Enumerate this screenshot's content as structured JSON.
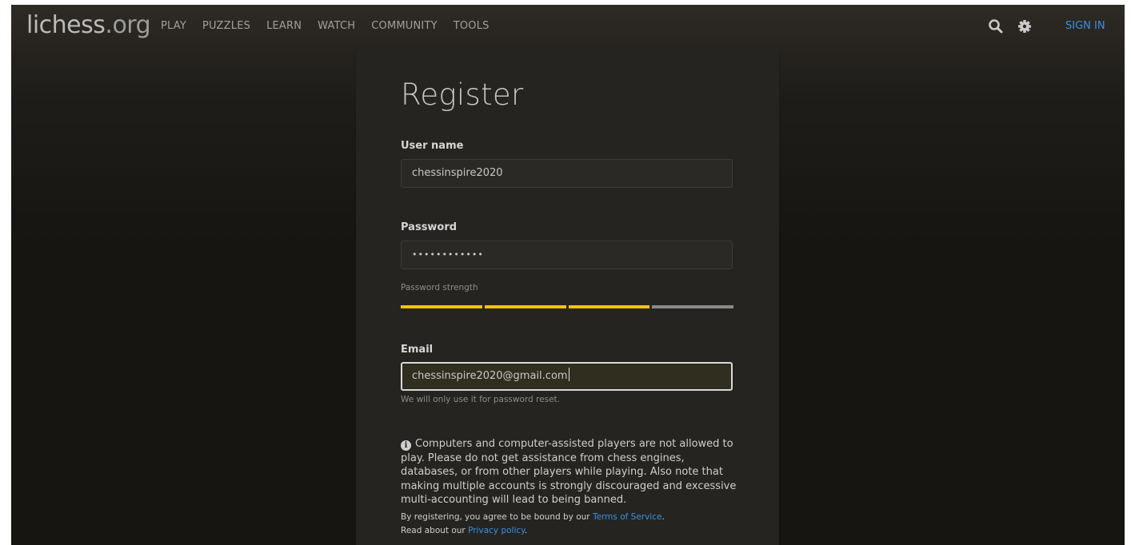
{
  "header": {
    "logo_main": "lichess",
    "logo_tld": ".org",
    "nav": [
      "PLAY",
      "PUZZLES",
      "LEARN",
      "WATCH",
      "COMMUNITY",
      "TOOLS"
    ],
    "sign_in": "SIGN IN",
    "icons": [
      "search-icon",
      "gear-icon"
    ]
  },
  "form": {
    "title": "Register",
    "username_label": "User name",
    "username_value": "chessinspire2020",
    "password_label": "Password",
    "password_value": "••••••••••••",
    "strength_label": "Password strength",
    "strength_level": 0.75,
    "email_label": "Email",
    "email_value": "chessinspire2020@gmail.com",
    "email_hint": "We will only use it for password reset."
  },
  "notice": {
    "icon": "info-icon",
    "text": "Computers and computer-assisted players are not allowed to play. Please do not get assistance from chess engines, databases, or from other players while playing. Also note that making multiple accounts is strongly discouraged and excessive multi-accounting will lead to being banned.",
    "terms_prefix": "By registering, you agree to be bound by our ",
    "terms_link": "Terms of Service",
    "terms_suffix": ".",
    "privacy_prefix": "Read about our ",
    "privacy_link": "Privacy policy",
    "privacy_suffix": "."
  },
  "colors": {
    "accent_link": "#3692e7",
    "strength_on": "#f2c500",
    "strength_off": "#8a8a8a",
    "panel_bg": "#262421"
  }
}
